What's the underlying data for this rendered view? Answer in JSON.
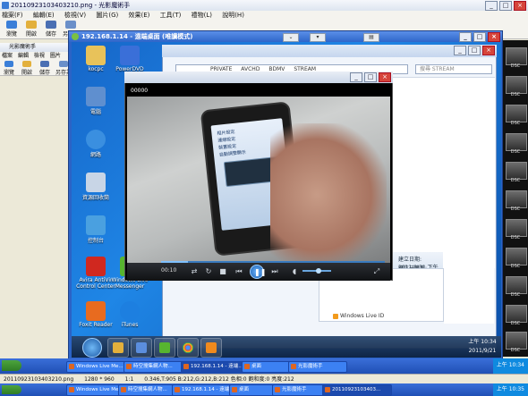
{
  "outer": {
    "title": "20110923103403210.png - 光影魔術手",
    "menu": [
      "檔案(F)",
      "編輯(E)",
      "檢視(V)",
      "圖片(G)",
      "效果(E)",
      "工具(T)",
      "禮物(L)",
      "說明(H)"
    ],
    "toolbar": [
      "瀏覽",
      "開啟",
      "儲存",
      "另存為"
    ]
  },
  "viewer2": {
    "title": "光影魔術手",
    "menu": [
      "檔案",
      "編輯",
      "檢視",
      "圖片"
    ],
    "toolbar": [
      "瀏覽",
      "開啟",
      "儲存",
      "另存為"
    ]
  },
  "vnc": {
    "title": "192.168.1.14 - 遠端桌面 (唯讀模式)"
  },
  "desktop_icons": [
    {
      "label": "kocpc",
      "color": "#e8c25a"
    },
    {
      "label": "PowerDVD",
      "color": "#3a6fd8"
    },
    {
      "label": "電腦",
      "color": "#5f8fcf"
    },
    {
      "label": "網路",
      "color": "#3a8fe0"
    },
    {
      "label": "資源回收筒",
      "color": "#c8d5e6"
    },
    {
      "label": "控制台",
      "color": "#4aa0e0"
    },
    {
      "label": "Avira AntiVir Control Center",
      "color": "#d0281f"
    },
    {
      "label": "Foxit Reader",
      "color": "#e86b1f"
    },
    {
      "label": "iTunes",
      "color": "#1d7fe0"
    },
    {
      "label": "Windows Live Messenger",
      "color": "#57b52f"
    }
  ],
  "explorer": {
    "breadcrumb": [
      "PRIVATE",
      "AVCHD",
      "BDMV",
      "STREAM"
    ],
    "search_placeholder": "搜尋 STREAM",
    "date_label": "建立日期: 2011/8/31 下午 09:45",
    "bitrate_label": "總位元速率: 16060kbps"
  },
  "windows_live": {
    "label": "Windows Live ID"
  },
  "player": {
    "top_time": "00000",
    "current_time": "00:10",
    "progress_pct": 12,
    "volume_pct": 55
  },
  "phone_screen_lines": [
    "相片設定",
    "連線設定",
    "裝置設定",
    "自動調整顯示"
  ],
  "w7_clock": {
    "time": "上午 10:34",
    "date": "2011/9/21"
  },
  "taskbar1": {
    "buttons": [
      "Windows Live Me...",
      "時空搜集網人物...",
      "192.168.1.14 - 遠端...",
      "桌面",
      "光影魔術手"
    ],
    "tray": "上午 10:34"
  },
  "status": {
    "items": [
      "20110923103403210.png",
      "1280 * 960",
      "1:1",
      "0.346,T:905 B:212,G:212,B:212 色相:0 飽和度:0 亮度:212"
    ]
  },
  "taskbar2": {
    "buttons": [
      "Windows Live Me...",
      "時空搜集網人物...",
      "192.168.1.14 - 遠端...",
      "桌面",
      "光影魔術手",
      "20110923103403..."
    ],
    "tray": "上午 10:35"
  },
  "strip_labels": [
    "DSC",
    "DSC",
    "DSC",
    "DSC",
    "DSC",
    "DSC",
    "DSC",
    "DSC",
    "DSC",
    "DSC",
    "DSC"
  ]
}
